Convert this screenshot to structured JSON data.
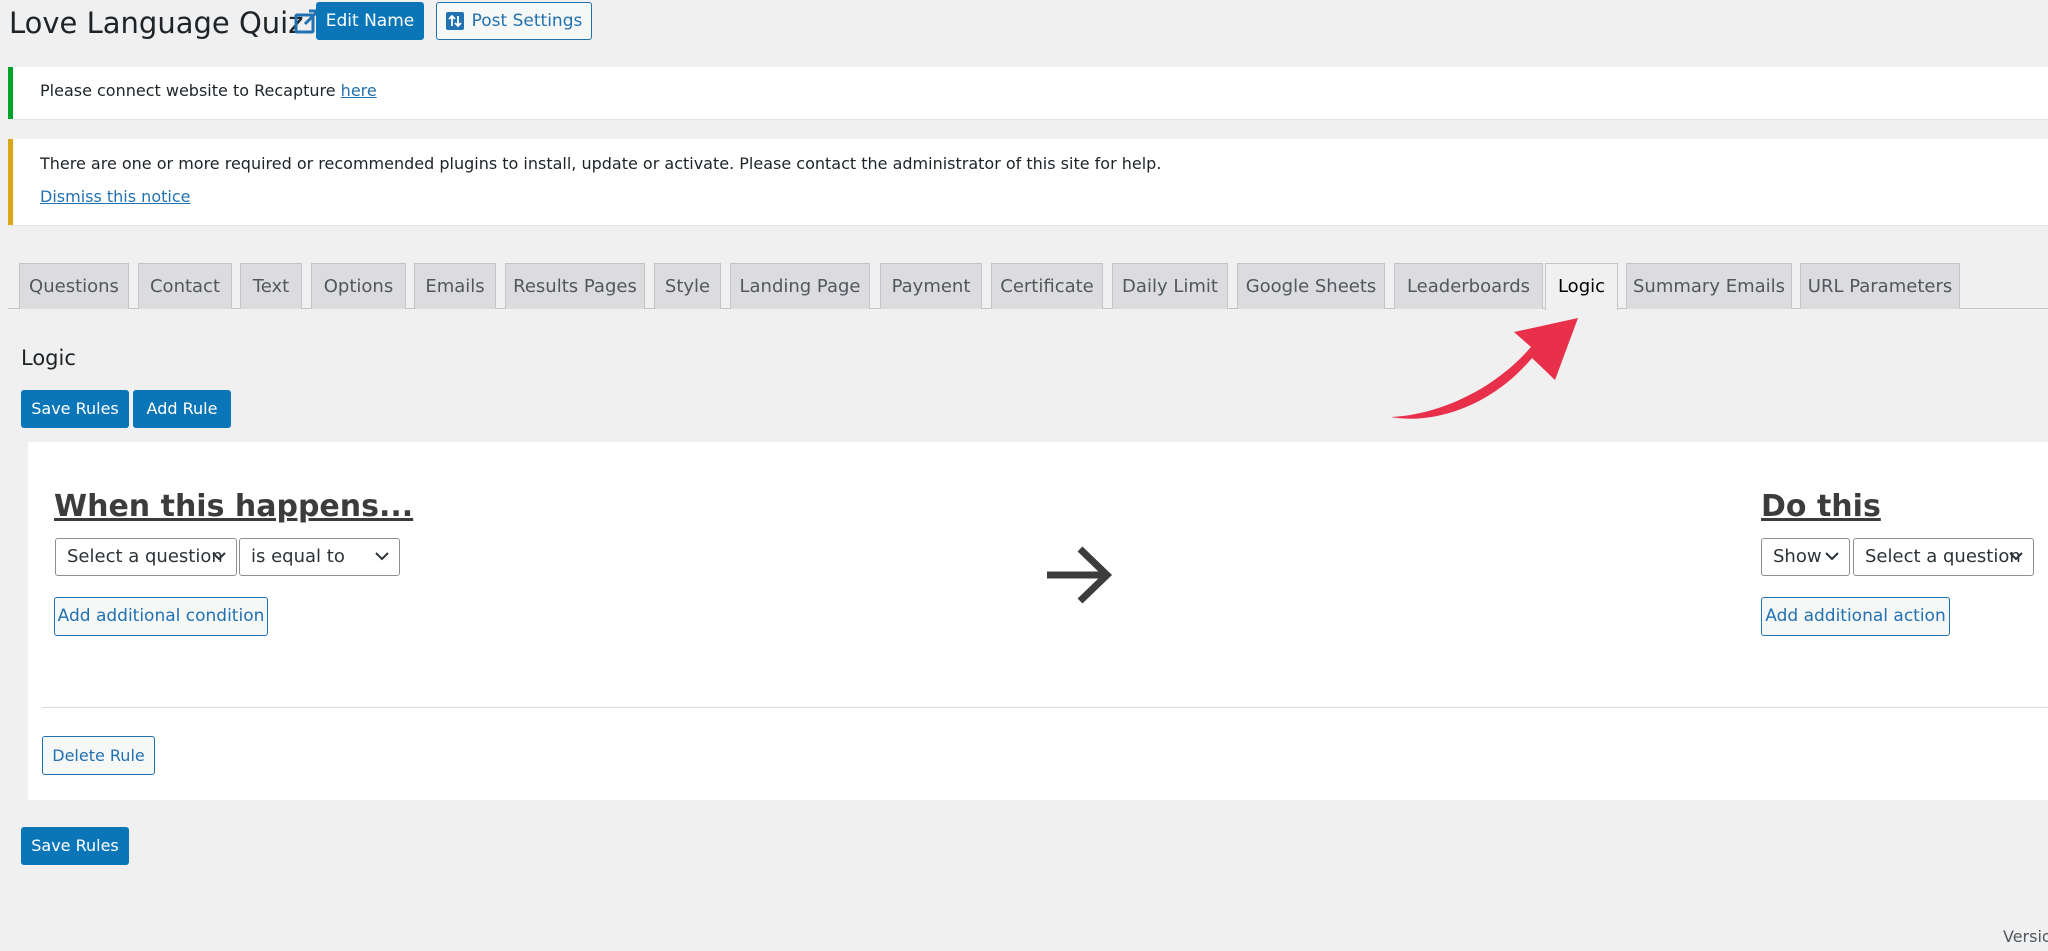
{
  "header": {
    "title": "Love Language Quiz",
    "edit_name_label": "Edit Name",
    "post_settings_label": "Post Settings"
  },
  "notices": {
    "recapture": {
      "text": "Please connect website to Recapture ",
      "link": "here"
    },
    "plugins": {
      "text": "There are one or more required or recommended plugins to install, update or activate. Please contact the administrator of this site for help.",
      "dismiss": "Dismiss this notice"
    }
  },
  "tabs": [
    {
      "label": "Questions"
    },
    {
      "label": "Contact"
    },
    {
      "label": "Text"
    },
    {
      "label": "Options"
    },
    {
      "label": "Emails"
    },
    {
      "label": "Results Pages"
    },
    {
      "label": "Style"
    },
    {
      "label": "Landing Page"
    },
    {
      "label": "Payment"
    },
    {
      "label": "Certificate"
    },
    {
      "label": "Daily Limit"
    },
    {
      "label": "Google Sheets"
    },
    {
      "label": "Leaderboards"
    },
    {
      "label": "Logic",
      "active": true
    },
    {
      "label": "Summary Emails"
    },
    {
      "label": "URL Parameters"
    }
  ],
  "logic": {
    "heading": "Logic",
    "save_rules_label": "Save Rules",
    "add_rule_label": "Add Rule",
    "rule": {
      "when_heading": "When this happens...",
      "condition": {
        "question_select": "Select a question",
        "operator_select": "is equal to"
      },
      "add_condition_label": "Add additional condition",
      "do_heading": "Do this",
      "action": {
        "action_select": "Show",
        "question_select": "Select a question"
      },
      "add_action_label": "Add additional action",
      "delete_rule_label": "Delete Rule"
    }
  },
  "footer": {
    "version_text": "Versio"
  },
  "colors": {
    "primary": "#0a76b8",
    "link": "#2271b1",
    "notice_success": "#00a32a",
    "notice_warning": "#dba617",
    "annotation_arrow": "#e8304a",
    "page_bg": "#f0f0f1"
  }
}
